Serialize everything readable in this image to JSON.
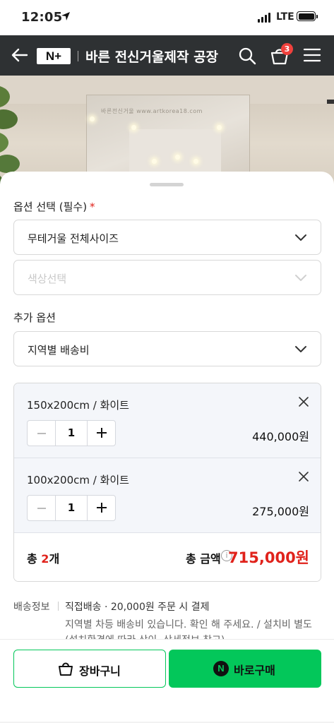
{
  "status_bar": {
    "time": "12:05",
    "network": "LTE"
  },
  "header": {
    "logo": "N+",
    "title": "바른 전신거울제작 공장",
    "cart_count": "3"
  },
  "photo": {
    "watermark": "바른전신거울 www.artkorea18.com"
  },
  "options": {
    "required_label": "옵션 선택 (필수)",
    "required_mark": "*",
    "select_1_value": "무테거울 전체사이즈",
    "select_2_placeholder": "색상선택",
    "extra_label": "추가 옵션",
    "extra_value": "지역별 배송비"
  },
  "selected_items": [
    {
      "name": "150x200cm / 화이트",
      "qty": "1",
      "price": "440,000원"
    },
    {
      "name": "100x200cm / 화이트",
      "qty": "1",
      "price": "275,000원"
    }
  ],
  "total": {
    "count_prefix": "총 ",
    "count_num": "2",
    "count_suffix": "개",
    "label": "총 금액",
    "info": "i",
    "amount": "715,000원"
  },
  "shipping": {
    "label": "배송정보",
    "main": "직접배송 · 20,000원 주문 시 결제",
    "sub": "지역별 차등 배송비 있습니다. 확인 해 주세요. / 설치비 별도 (설치환경에 따라 상이, 상세정보 참고)"
  },
  "actions": {
    "cart": "장바구니",
    "buy": "바로구매",
    "buy_icon": "N"
  },
  "colors": {
    "naver_green": "#03c75a",
    "price_red": "#e0221b",
    "header_bg": "#2e3133"
  }
}
